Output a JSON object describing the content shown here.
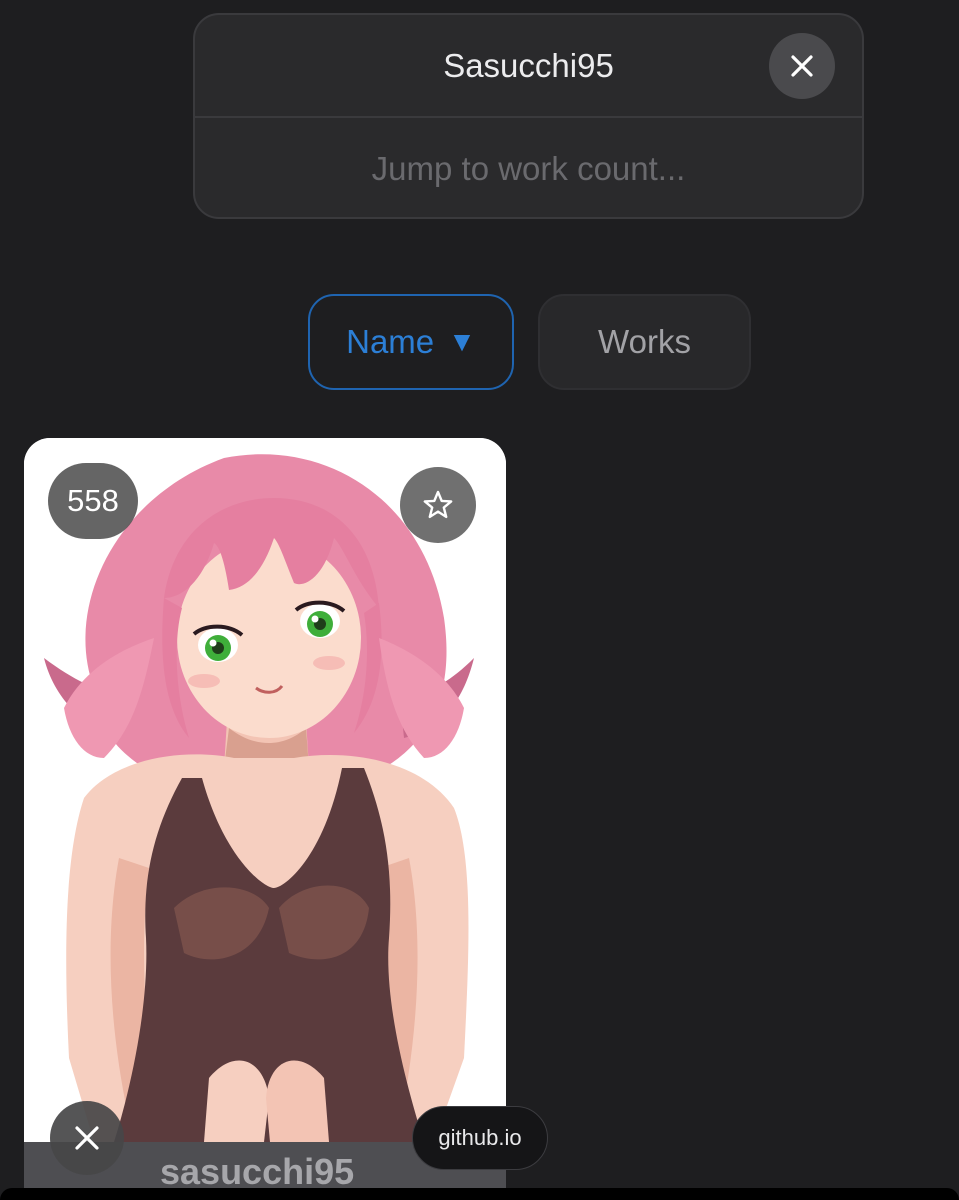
{
  "search": {
    "query": "Sasucchi95",
    "jump_placeholder": "Jump to work count..."
  },
  "sort": {
    "name_label": "Name",
    "name_arrow": "▼",
    "works_label": "Works"
  },
  "card": {
    "work_count": "558",
    "name": "sasucchi95",
    "favorite_icon": "star-outline-icon"
  },
  "browser": {
    "domain": "github.io",
    "close_icon": "close-icon"
  },
  "colors": {
    "background": "#1e1e20",
    "panel": "#2a2a2c",
    "accent": "#2c7fd6",
    "card": "#ffffff"
  }
}
